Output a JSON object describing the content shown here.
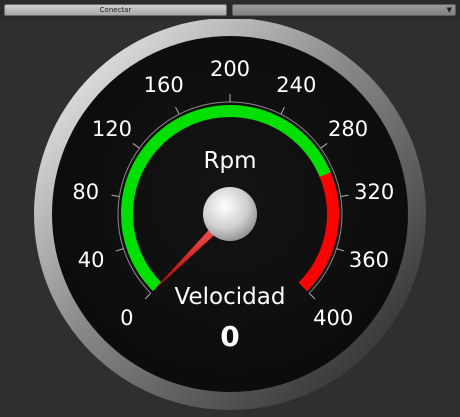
{
  "toolbar": {
    "connect_label": "Conectar",
    "port_value": ""
  },
  "gauge": {
    "unit": "Rpm",
    "title": "Velocidad",
    "value": 0,
    "value_text": "0",
    "min": 0,
    "max": 400,
    "tick_labels": [
      "0",
      "40",
      "80",
      "120",
      "160",
      "200",
      "240",
      "280",
      "320",
      "360",
      "400"
    ],
    "green_range": [
      0,
      300
    ],
    "red_range": [
      300,
      400
    ],
    "colors": {
      "green": "#00e000",
      "red": "#ff0000",
      "needle": "#e01010",
      "face": "#111111",
      "background": "#2f2f2f"
    }
  }
}
